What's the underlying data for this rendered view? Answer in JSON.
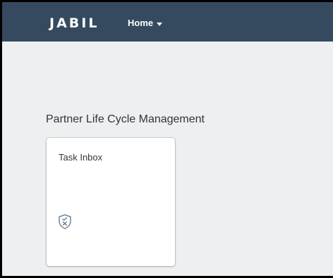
{
  "shellbar": {
    "logo_text": "JABIL",
    "menu_label": "Home"
  },
  "group": {
    "title": "Partner Life Cycle Management"
  },
  "tiles": [
    {
      "title": "Task Inbox",
      "icon": "shield-check-x-icon"
    }
  ],
  "colors": {
    "shellbar_bg": "#354a5f",
    "page_bg": "#edeff0",
    "tile_bg": "#ffffff",
    "text": "#32363a",
    "icon": "#5b738b"
  }
}
